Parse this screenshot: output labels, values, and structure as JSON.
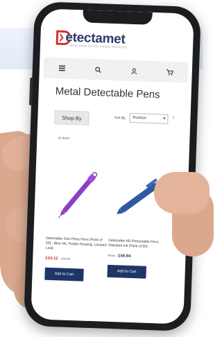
{
  "brand": {
    "name": "etectamet",
    "tagline": "DETECTABLE & X-RAY VISIBLE PRODUCTS"
  },
  "nav": {
    "menu_icon": "menu-icon",
    "search_icon": "search-icon",
    "account_icon": "user-icon",
    "cart_icon": "cart-icon"
  },
  "page": {
    "title": "Metal Detectable Pens",
    "shop_by": "Shop By",
    "sort_by_label": "Sort By",
    "sort_selected": "Position",
    "sort_direction": "↑",
    "item_count": "44 Items"
  },
  "products": [
    {
      "name": "Detectable One Piece Pens (Pack of 50) - Blue Ink, Purple Housing, Lanyard Loop",
      "price": "£24.12",
      "old_price": "£30.15",
      "button": "Add to Cart",
      "color": "#8a3fc4"
    },
    {
      "name": "Detectable HD Retractable Pens - Standard Ink (Pack of 50)",
      "price_prefix": "From",
      "price": "£49.94",
      "button": "Add to Cart",
      "color": "#2d5aa0"
    }
  ],
  "colors": {
    "brand_navy": "#1f3566",
    "brand_red": "#d0312d"
  }
}
